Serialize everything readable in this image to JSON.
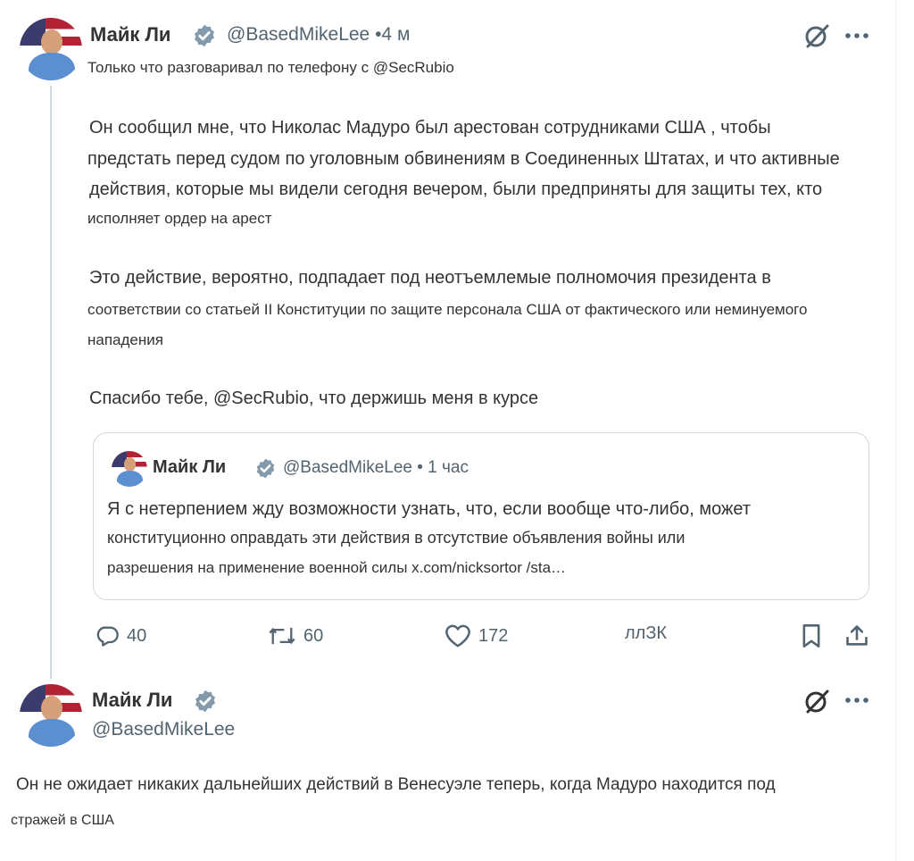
{
  "tweet1": {
    "author_name": "Майк Ли",
    "handle_time": "@BasedMikeLee •4 м",
    "intro": "Только что разговаривал по телефону с @SecRubio",
    "p1": [
      "Он сообщил мне, что Николас Мадуро был арестован сотрудниками США , чтобы",
      "предстать перед судом по уголовным обвинениям в Соединенных Штатах, и что активные",
      "действия, которые мы видели сегодня вечером, были предприняты для защиты тех, кто",
      "исполняет ордер на арест"
    ],
    "p2": [
      "Это действие, вероятно, подпадает под неотъемлемые полномочия президента в",
      "соответствии со статьей II Конституции по защите персонала США от фактического или неминуемого",
      "нападения"
    ],
    "p3": "Спасибо тебе, @SecRubio, что держишь меня в курсе",
    "quote": {
      "author_name": "Майк Ли",
      "handle_time": "@BasedMikeLee • 1 час",
      "lines": [
        "Я с нетерпением жду возможности узнать, что, если вообще что-либо, может",
        "конституционно оправдать эти действия в отсутствие объявления войны или",
        "разрешения на применение военной силы x.com/nicksortor /sta…"
      ]
    },
    "actions": {
      "replies": "40",
      "reposts": "60",
      "likes": "172",
      "views": "ллЗК"
    }
  },
  "tweet2": {
    "author_name": "Майк Ли",
    "handle": "@BasedMikeLee",
    "lines": [
      "Он не ожидает никаких дальнейших действий в Венесуэле теперь, когда Мадуро находится под",
      "стражей в США"
    ]
  },
  "icons": {
    "verified": "verified-badge-icon",
    "grok": "grok-icon",
    "more": "more-icon",
    "reply": "reply-icon",
    "repost": "repost-icon",
    "like": "like-icon",
    "views": "views-icon",
    "bookmark": "bookmark-icon",
    "share": "share-icon"
  },
  "colors": {
    "verified": "#829aab",
    "text": "#333333",
    "secondary": "#536471",
    "border": "#cfd9de"
  }
}
